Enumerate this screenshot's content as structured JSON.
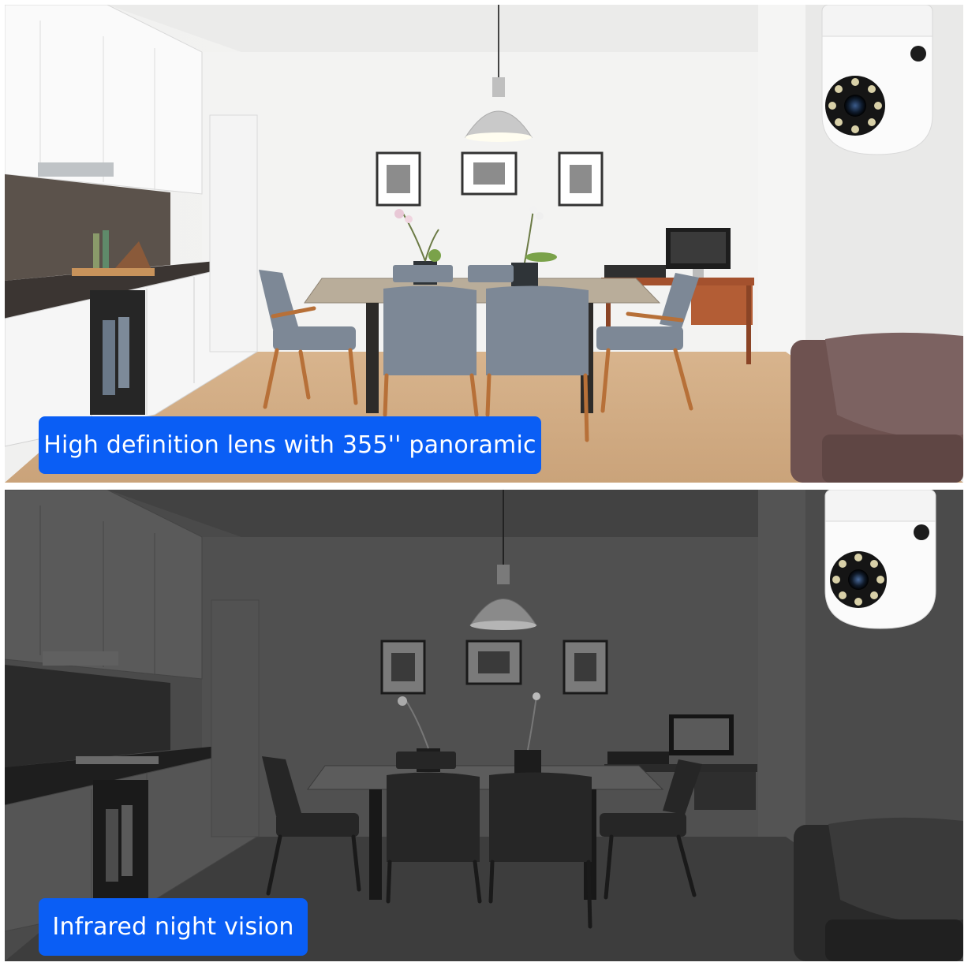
{
  "panels": {
    "day": {
      "caption": "High definition lens with 355'' panoramic"
    },
    "night": {
      "caption": "Infrared night vision"
    }
  },
  "colors": {
    "caption_background": "#0a5ef5",
    "caption_text": "#ffffff",
    "page_background": "#ffffff"
  }
}
